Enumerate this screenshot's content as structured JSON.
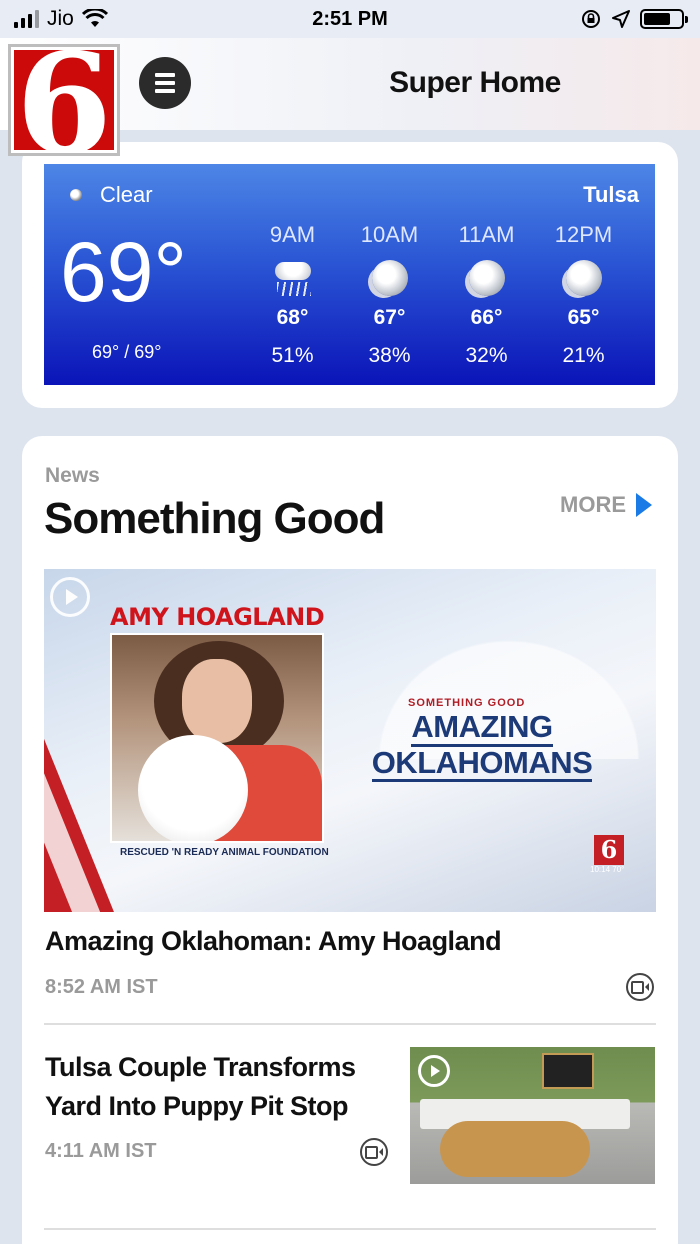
{
  "status_bar": {
    "carrier": "Jio",
    "time": "2:51 PM"
  },
  "header": {
    "logo_text": "6",
    "title": "Super Home"
  },
  "weather": {
    "condition": "Clear",
    "city": "Tulsa",
    "current_temp": "69°",
    "hi_lo": "69° / 69°",
    "hours": [
      {
        "time": "9AM",
        "icon": "rain-cloud-icon",
        "temp": "68°",
        "precip": "51%"
      },
      {
        "time": "10AM",
        "icon": "night-clear-icon",
        "temp": "67°",
        "precip": "38%"
      },
      {
        "time": "11AM",
        "icon": "night-clear-icon",
        "temp": "66°",
        "precip": "32%"
      },
      {
        "time": "12PM",
        "icon": "night-clear-icon",
        "temp": "65°",
        "precip": "21%"
      }
    ]
  },
  "news": {
    "section_label": "News",
    "section_title": "Something Good",
    "more_label": "MORE",
    "hero": {
      "name_overlay": "AMY HOAGLAND",
      "caption_overlay": "RESCUED 'N READY ANIMAL FOUNDATION",
      "brand_small": "SOMETHING GOOD",
      "brand_line1": "AMAZING",
      "brand_line2": "OKLAHOMANS",
      "badge": "6",
      "badge_sub": "10:14 70°"
    },
    "articles": [
      {
        "title": "Amazing Oklahoman: Amy Hoagland",
        "time": "8:52 AM IST"
      },
      {
        "title": "Tulsa Couple Transforms Yard Into Puppy Pit Stop",
        "time": "4:11 AM IST"
      }
    ]
  }
}
